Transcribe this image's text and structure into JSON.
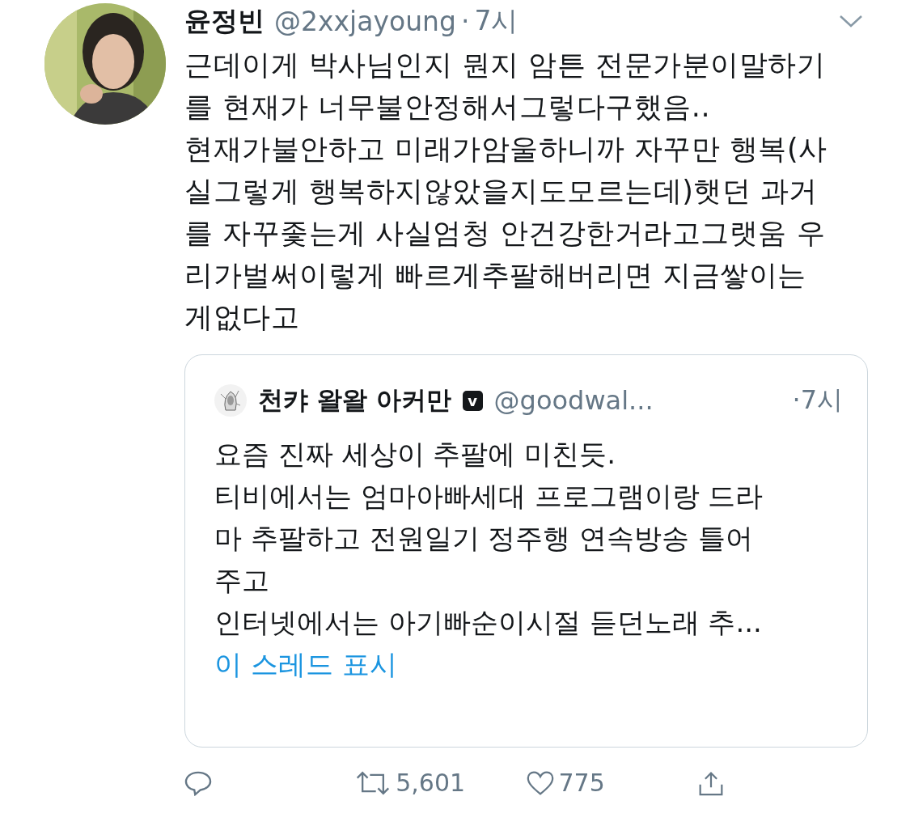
{
  "tweet": {
    "author_name": "윤정빈",
    "handle": "@2xxjayoung",
    "separator": "·",
    "time": "7시",
    "body_lines": [
      "근데이게 박사님인지 뭔지 암튼 전문가분이말하기",
      "를  현재가 너무불안정해서그렇다구했음..",
      "현재가불안하고 미래가암울하니까 자꾸만 행복(사",
      "실그렇게 행복하지않았을지도모르는데)햇던 과거",
      "를 자꾸좇는게 사실엄청 안건강한거라고그랫움 우",
      "리가벌써이렇게 빠르게추팔해버리면 지금쌓이는",
      "게없다고"
    ],
    "quoted": {
      "author_name": "천캬 왈왈 아커만",
      "badge": "v",
      "handle": "@goodwal...",
      "time": "·7시",
      "body_lines": [
        "요즘 진짜 세상이 추팔에 미친듯.",
        "티비에서는 엄마아빠세대 프로그램이랑 드라",
        "마 추팔하고 전원일기 정주행 연속방송 틀어",
        "주고",
        "인터넷에서는 아기빠순이시절 듣던노래 추..."
      ],
      "thread_link": "이 스레드 표시"
    },
    "actions": [
      {
        "kind": "reply"
      },
      {
        "kind": "retweet",
        "count": "5,601"
      },
      {
        "kind": "like",
        "count": "775"
      },
      {
        "kind": "share"
      }
    ]
  }
}
